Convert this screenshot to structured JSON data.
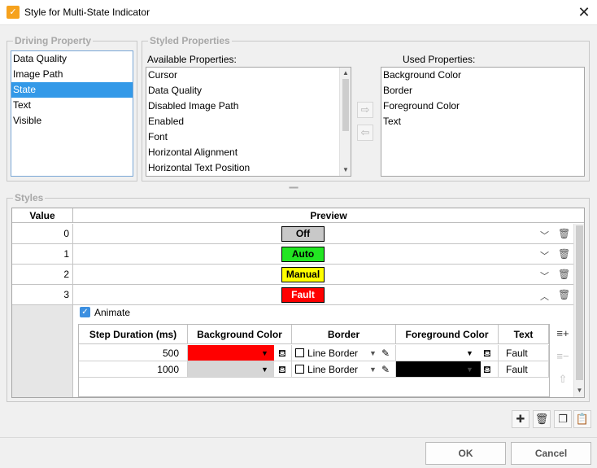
{
  "window": {
    "title": "Style for Multi-State Indicator"
  },
  "driving": {
    "legend": "Driving Property",
    "items": [
      {
        "label": "Data Quality",
        "selected": false
      },
      {
        "label": "Image Path",
        "selected": false
      },
      {
        "label": "State",
        "selected": true
      },
      {
        "label": "Text",
        "selected": false
      },
      {
        "label": "Visible",
        "selected": false
      }
    ]
  },
  "styled": {
    "legend": "Styled Properties",
    "available_label": "Available Properties:",
    "available": [
      "Cursor",
      "Data Quality",
      "Disabled Image Path",
      "Enabled",
      "Font",
      "Horizontal Alignment",
      "Horizontal Text Position"
    ],
    "used_label": "Used Properties:",
    "used": [
      "Background Color",
      "Border",
      "Foreground Color",
      "Text"
    ]
  },
  "styles": {
    "legend": "Styles",
    "col_value": "Value",
    "col_preview": "Preview",
    "rows": [
      {
        "value": "0",
        "text": "Off",
        "bg": "#c8c8c8",
        "fg": "#000000"
      },
      {
        "value": "1",
        "text": "Auto",
        "bg": "#22e622",
        "fg": "#000000"
      },
      {
        "value": "2",
        "text": "Manual",
        "bg": "#ffff00",
        "fg": "#000000"
      },
      {
        "value": "3",
        "text": "Fault",
        "bg": "#ff0000",
        "fg": "#ffffff"
      }
    ],
    "animate_label": "Animate",
    "animate_checked": true,
    "anim_headers": [
      "Step Duration (ms)",
      "Background Color",
      "Border",
      "Foreground Color",
      "Text"
    ],
    "anim_rows": [
      {
        "duration": "500",
        "bg": "#ff0000",
        "border": "Line Border",
        "fg": "#ffffff",
        "text": "Fault"
      },
      {
        "duration": "1000",
        "bg": "#d6d6d6",
        "border": "Line Border",
        "fg": "#000000",
        "text": "Fault"
      }
    ]
  },
  "footer": {
    "ok": "OK",
    "cancel": "Cancel"
  }
}
